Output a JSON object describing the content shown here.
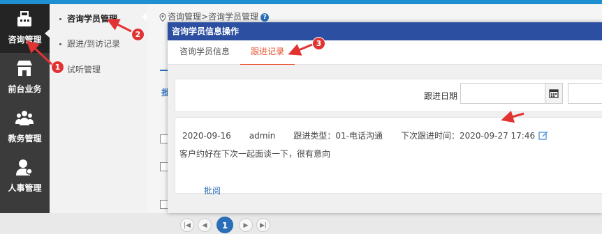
{
  "nav": [
    {
      "label": "咨询管理",
      "icon": "register-icon",
      "active": true
    },
    {
      "label": "前台业务",
      "icon": "store-icon",
      "active": false
    },
    {
      "label": "教务管理",
      "icon": "group-icon",
      "active": false
    },
    {
      "label": "人事管理",
      "icon": "person-icon",
      "active": false
    }
  ],
  "submenu": [
    {
      "label": "咨询学员管理",
      "active": true
    },
    {
      "label": "跟进/到访记录",
      "active": false
    },
    {
      "label": "试听管理",
      "active": false
    }
  ],
  "breadcrumb": {
    "text": "咨询管理>咨询学员管理"
  },
  "background": {
    "tab_char": "批"
  },
  "dialog": {
    "title": "咨询学员信息操作",
    "tabs": [
      {
        "label": "咨询学员信息",
        "active": false
      },
      {
        "label": "跟进记录",
        "active": true
      }
    ],
    "filter": {
      "label": "跟进日期",
      "start_value": "",
      "end_value": ""
    },
    "record": {
      "date": "2020-09-16",
      "user": "admin",
      "type": "跟进类型：01-电话沟通",
      "next": "下次跟进时间：2020-09-27 17:46",
      "note": "客户约好在下次一起面谈一下，很有意向",
      "link": "批阅"
    },
    "pager": {
      "current": "1"
    }
  },
  "annotations": [
    "1",
    "2",
    "3"
  ],
  "colors": {
    "accent": "#e8502e",
    "title_bar": "#2c4fa1",
    "link": "#2a6eb8",
    "annotation": "#e23333"
  }
}
